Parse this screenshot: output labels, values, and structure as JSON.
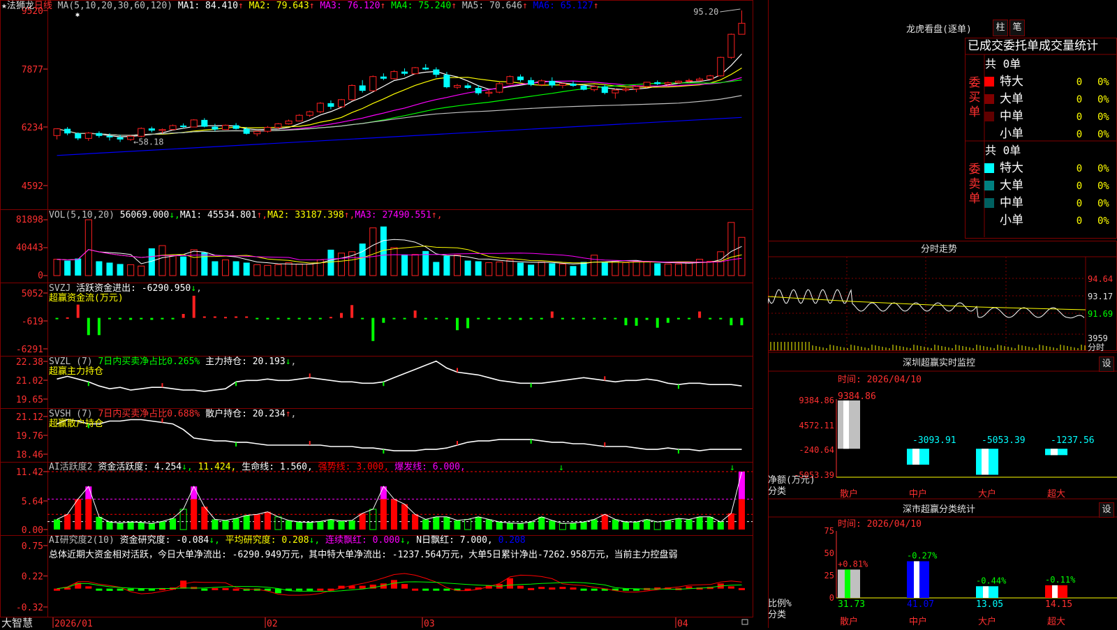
{
  "colors": {
    "up": "#ff2020",
    "down": "#00ffff",
    "ma1": "#ffffff",
    "ma2": "#ffff00",
    "ma3": "#ff00ff",
    "ma4": "#00ff00",
    "ma5": "#c0c0c0",
    "ma6": "#0000ff",
    "grid": "#800000"
  },
  "toolbar": {
    "title": "★法狮龙",
    "period": "日线"
  },
  "main": {
    "ma_label": "MA(5,10,20,30,60,120)",
    "ma": [
      {
        "label": "MA1: 84.410",
        "arrow": "↑",
        "color": "#ffffff"
      },
      {
        "label": "MA2: 79.643",
        "arrow": "↑",
        "color": "#ffff00"
      },
      {
        "label": "MA3: 76.120",
        "arrow": "↑",
        "color": "#ff00ff"
      },
      {
        "label": "MA4: 75.240",
        "arrow": "↑",
        "color": "#00ff00"
      },
      {
        "label": "MA5: 70.646",
        "arrow": "↑",
        "color": "#c0c0c0"
      },
      {
        "label": "MA6: 65.127",
        "arrow": "↑",
        "color": "#0000ff"
      }
    ],
    "y_ticks": [
      "9520",
      "7877",
      "6234",
      "4592"
    ],
    "high_label": "95.20",
    "low_label": "←58.18",
    "candles": [
      [
        60,
        62,
        58.9,
        61.9
      ],
      [
        61.9,
        62.4,
        60.1,
        60.6
      ],
      [
        60.6,
        60.9,
        58.7,
        59.2
      ],
      [
        59.2,
        61,
        58.5,
        60.7
      ],
      [
        60.7,
        61.2,
        59.4,
        59.9
      ],
      [
        59.9,
        60.6,
        58.6,
        59.5
      ],
      [
        59.5,
        60.2,
        58.2,
        58.9
      ],
      [
        58.9,
        60.1,
        58.5,
        59.8
      ],
      [
        59.8,
        62.3,
        59.5,
        62
      ],
      [
        62,
        62.5,
        60.9,
        61.4
      ],
      [
        61.4,
        62,
        60.6,
        61.7
      ],
      [
        61.7,
        63.1,
        61.5,
        62.8
      ],
      [
        62.8,
        63.4,
        62,
        62.4
      ],
      [
        62.4,
        64.6,
        62.4,
        64.4
      ],
      [
        64.4,
        64.9,
        62.3,
        62.5
      ],
      [
        62.5,
        63.3,
        61.2,
        61.7
      ],
      [
        61.7,
        63.1,
        61.6,
        62.9
      ],
      [
        62.9,
        63.5,
        61.7,
        61.9
      ],
      [
        61.9,
        62.4,
        60.3,
        60.5
      ],
      [
        60.5,
        61.4,
        59.8,
        61.2
      ],
      [
        61.2,
        62.7,
        60.8,
        62.3
      ],
      [
        62.3,
        63.5,
        61.8,
        63.3
      ],
      [
        63.3,
        64.5,
        63.1,
        64.1
      ],
      [
        64.1,
        66,
        64,
        65.7
      ],
      [
        65.7,
        67,
        65.2,
        66.7
      ],
      [
        66.7,
        69.4,
        66.3,
        69.1
      ],
      [
        69.1,
        69.9,
        67.4,
        68.1
      ],
      [
        68.1,
        70.3,
        68,
        70.1
      ],
      [
        70.1,
        74.4,
        69.8,
        74.1
      ],
      [
        74.1,
        75.6,
        72.1,
        72.6
      ],
      [
        72.6,
        76.9,
        72.4,
        76.6
      ],
      [
        76.6,
        77.5,
        75.6,
        76
      ],
      [
        76,
        78.4,
        75.8,
        78
      ],
      [
        78,
        78.9,
        76.9,
        77.4
      ],
      [
        77.4,
        79.3,
        77.2,
        79.1
      ],
      [
        79.1,
        80.1,
        78.4,
        78.6
      ],
      [
        78.6,
        79.2,
        76.4,
        77.1
      ],
      [
        77.1,
        77.9,
        73.3,
        73.6
      ],
      [
        73.6,
        74.5,
        73.1,
        74.1
      ],
      [
        74.1,
        74.7,
        73.1,
        73.4
      ],
      [
        73.4,
        74.2,
        71.4,
        71.9
      ],
      [
        71.9,
        73,
        70.9,
        72.2
      ],
      [
        72.2,
        75,
        71.9,
        74.6
      ],
      [
        74.6,
        76.9,
        74.4,
        76.6
      ],
      [
        76.6,
        77.2,
        75.1,
        75.6
      ],
      [
        75.6,
        76.4,
        73.9,
        74.3
      ],
      [
        74.3,
        75.8,
        73.9,
        75.4
      ],
      [
        75.4,
        76.4,
        73.5,
        74.1
      ],
      [
        74.1,
        74.8,
        73.3,
        74.6
      ],
      [
        74.6,
        75.3,
        73.7,
        74
      ],
      [
        74,
        74.4,
        72.7,
        72.9
      ],
      [
        72.9,
        74.2,
        72.4,
        73.8
      ],
      [
        73.8,
        74.4,
        71.6,
        72
      ],
      [
        72,
        73.2,
        70.4,
        72.8
      ],
      [
        72.8,
        73.5,
        72.3,
        73.1
      ],
      [
        73.1,
        74.1,
        72.2,
        73.8
      ],
      [
        73.8,
        75.1,
        73.4,
        75
      ],
      [
        75,
        75.5,
        74.2,
        74.5
      ],
      [
        74.5,
        75.2,
        74,
        74.9
      ],
      [
        74.9,
        75.5,
        74.6,
        75.3
      ],
      [
        75.3,
        76,
        74.9,
        75.5
      ],
      [
        75.5,
        76.4,
        75.3,
        75.9
      ],
      [
        75.9,
        77.1,
        75.5,
        76.8
      ],
      [
        76.8,
        82.2,
        76.6,
        82
      ],
      [
        82,
        88.7,
        81.6,
        88.5
      ],
      [
        88.5,
        95.2,
        88.5,
        91.6
      ]
    ],
    "ma6_range": [
      54.4,
      65.1
    ]
  },
  "vol": {
    "label": "VOL(5,10,20)",
    "value": "56069.000",
    "arrow": "↓",
    "ma": [
      {
        "label": "MA1: 45534.801",
        "arrow": "↑",
        "color": "#ffffff"
      },
      {
        "label": "MA2: 33187.398",
        "arrow": "↑",
        "color": "#ffff00"
      },
      {
        "label": "MA3: 27490.551",
        "arrow": "↑",
        "color": "#ff00ff"
      }
    ],
    "y_ticks": [
      "81898",
      "40443",
      "0"
    ],
    "values": [
      24000,
      22000,
      25000,
      81898,
      21000,
      19000,
      17000,
      16000,
      14000,
      40000,
      44000,
      29000,
      28000,
      38000,
      34000,
      21000,
      23000,
      21000,
      19000,
      16000,
      15000,
      16000,
      19000,
      17000,
      17000,
      23000,
      38000,
      33000,
      35000,
      47000,
      70000,
      72000,
      41000,
      31000,
      31000,
      36000,
      20000,
      29000,
      30000,
      22000,
      21000,
      19000,
      20000,
      23000,
      19000,
      16000,
      20000,
      18000,
      17000,
      14000,
      20000,
      30000,
      20000,
      21000,
      19000,
      21000,
      20000,
      18000,
      17000,
      17000,
      19000,
      24000,
      21000,
      35000,
      78000,
      56069
    ]
  },
  "svzj": {
    "label": "SVZJ",
    "text": "活跃资金进出: -6290.950",
    "arrow": "↓",
    "suffix": ",",
    "sub": "超赢资金流(万元)",
    "y_ticks": [
      "5052",
      "-619",
      "-6291"
    ],
    "values": [
      -200,
      100,
      2700,
      -3500,
      -3500,
      -200,
      -300,
      -400,
      -300,
      -400,
      -300,
      -300,
      800,
      4500,
      300,
      300,
      200,
      300,
      300,
      -200,
      -300,
      -200,
      -300,
      -200,
      -300,
      -200,
      200,
      1000,
      2600,
      -200,
      -4700,
      -1000,
      -200,
      -200,
      1500,
      -300,
      -200,
      -200,
      -2500,
      -2100,
      -200,
      -300,
      -300,
      -300,
      -400,
      -300,
      -300,
      1300,
      -300,
      -200,
      -300,
      -200,
      -300,
      -200,
      -1500,
      -1600,
      -400,
      -2000,
      -1000,
      -300,
      -200,
      1300,
      -300,
      -300,
      -1500,
      -1500,
      500,
      -200,
      -6291
    ],
    "range": [
      -6291,
      5052
    ]
  },
  "svzl": {
    "label": "SVZL (7)",
    "text1": "7日内买卖净占比0.265%",
    "text2": "主力持仓: 20.193",
    "arrow": "↓",
    "suffix": ",",
    "sub": "超赢主力持仓",
    "y_ticks": [
      "22.38",
      "21.02",
      "19.65"
    ],
    "values": [
      21.1,
      21.3,
      21.1,
      20.9,
      20.6,
      20.4,
      20.5,
      20.3,
      20.4,
      20.5,
      20.5,
      20.4,
      20.3,
      20.3,
      20.2,
      20.3,
      20.4,
      20.9,
      21,
      21,
      21.1,
      21,
      21,
      21.1,
      21.2,
      21.1,
      21,
      20.9,
      20.9,
      20.8,
      20.8,
      20.9,
      21.2,
      21.5,
      21.8,
      22.1,
      22.4,
      21.9,
      21.6,
      21.5,
      21.4,
      21.2,
      21,
      20.9,
      20.8,
      20.8,
      20.8,
      20.9,
      21,
      21.1,
      21.2,
      21.1,
      21,
      20.9,
      21,
      21,
      21.1,
      21,
      20.8,
      20.7,
      20.8,
      20.8,
      20.7,
      20.7,
      20.7,
      20.6,
      20.6,
      20.6,
      20.5,
      20.5,
      20.4,
      20.2,
      19.8
    ],
    "range": [
      19.65,
      22.38
    ]
  },
  "svsh": {
    "label": "SVSH (7)",
    "text1": "7日内买卖净占比0.688%",
    "text2": "散户持仓: 20.234",
    "arrow": "↑",
    "suffix": ",",
    "sub": "超赢散户持仓",
    "y_ticks": [
      "21.12",
      "19.76",
      "18.46"
    ],
    "values": [
      20.6,
      20.9,
      20.8,
      20.6,
      20.6,
      20.8,
      20.8,
      20.9,
      20.9,
      20.8,
      20.7,
      20.6,
      20.2,
      19.6,
      19.5,
      19.4,
      19.4,
      19.3,
      19.3,
      19.2,
      19.1,
      19.1,
      19.1,
      19.1,
      19.1,
      19.1,
      19,
      19,
      19,
      18.9,
      18.9,
      18.8,
      18.7,
      18.7,
      18.7,
      18.8,
      18.8,
      18.9,
      19.1,
      19.3,
      19.4,
      19.4,
      19.5,
      19.5,
      19.5,
      19.5,
      19.4,
      19.3,
      19.3,
      19.2,
      19.2,
      19.1,
      19,
      19,
      19,
      18.9,
      18.8,
      18.8,
      18.9,
      18.8,
      18.8,
      18.7,
      18.8,
      18.8,
      18.8,
      18.8,
      18.7,
      18.7,
      18.8,
      18.9,
      18.9,
      19,
      19.1,
      19.3,
      20.2
    ],
    "range": [
      18.46,
      21.12
    ]
  },
  "ai1": {
    "label": "AI活跃度2",
    "text1": "资金活跃度: 4.254",
    "arrow": "↓",
    "text2": "11.424",
    "text3": "生命线: 1.560",
    "text4": "强势线: 3.000",
    "text5": "爆发线: 6.000",
    "y_ticks": [
      "11.42",
      "5.64",
      "0.00"
    ],
    "values": [
      2,
      3,
      6,
      8.5,
      2.5,
      1.5,
      1.3,
      1.5,
      1.4,
      1.2,
      1.6,
      2.2,
      4,
      8.5,
      4.5,
      2,
      1.8,
      2.2,
      2.8,
      3,
      3.5,
      2.5,
      1.8,
      1.5,
      1.4,
      1.6,
      2,
      1.7,
      1.8,
      3.2,
      4,
      8.5,
      6,
      5,
      3,
      2,
      2.5,
      2.5,
      1.8,
      2,
      2.5,
      2,
      1.5,
      1.3,
      1.2,
      1.5,
      2.5,
      1.8,
      1.2,
      1.3,
      1.5,
      2,
      3,
      2,
      1.5,
      1.5,
      2,
      1.5,
      1.8,
      2.2,
      2,
      2.5,
      2.5,
      1.5,
      3.2,
      11.42,
      4.254
    ],
    "max": 11.42
  },
  "ai2": {
    "label": "AI研究度2(10)",
    "text1": "资金研究度: -0.084",
    "arrow1": "↓",
    "text2": "平均研究度: 0.208",
    "arrow2": "↓",
    "text3": "连续飘红: 0.000",
    "arrow3": "↓",
    "text4": "N日飘红: 7.000",
    "text5": "0.208",
    "y_ticks": [
      "0.75",
      "0.22",
      "-0.32"
    ],
    "summary": "总体近期大资金相对活跃，今日大单净流出: -6290.949万元，其中特大单净流出: -1237.564万元，大单5日累计净出-7262.958万元，当前主力控盘弱",
    "values": [
      0,
      0.02,
      0.1,
      0.04,
      -0.03,
      -0.04,
      -0.03,
      -0.03,
      -0.02,
      -0.01,
      0.01,
      0.02,
      0.14,
      0.03,
      -0.02,
      0.01,
      0.01,
      0,
      -0.02,
      -0.02,
      -0.04,
      -0.08,
      -0.03,
      -0.02,
      -0.01,
      0,
      0,
      0.05,
      0.05,
      0.05,
      0.07,
      0.09,
      0.15,
      0.08,
      0,
      -0.02,
      -0.02,
      -0.01,
      -0.01,
      0,
      0.02,
      0.06,
      0.08,
      0.18,
      0.05,
      0.01,
      0.03,
      0.02,
      0.03,
      0.02,
      -0.01,
      -0.02,
      -0.02,
      -0.03,
      -0.02,
      -0.01,
      0.01,
      0.02,
      0.02,
      0.01,
      0.04,
      0.02,
      0.03,
      0.09,
      0.04,
      0.01,
      0.05,
      0.12,
      0.14,
      -0.084
    ],
    "range": [
      -0.32,
      0.75
    ]
  },
  "dates": [
    "2026/01",
    "02",
    "03",
    "04"
  ],
  "brand": "大智慧",
  "side": {
    "dragon_title": "龙虎看盘(逐单)",
    "btn_bar": "柱",
    "btn_pen": "笔",
    "stat_title": "已成交委托单成交量统计",
    "buy": {
      "side_label": "委买单",
      "total": "共 0单",
      "rows": [
        [
          "特大",
          "0",
          "0%",
          "#ff0000"
        ],
        [
          "大单",
          "0",
          "0%",
          "#800000"
        ],
        [
          "中单",
          "0",
          "0%",
          "#600000"
        ],
        [
          "小单",
          "0",
          "0%",
          ""
        ]
      ]
    },
    "sell": {
      "side_label": "委卖单",
      "total": "共 0单",
      "rows": [
        [
          "特大",
          "0",
          "0%",
          "#00ffff"
        ],
        [
          "大单",
          "0",
          "0%",
          "#008080"
        ],
        [
          "中单",
          "0",
          "0%",
          "#006060"
        ],
        [
          "小单",
          "0",
          "0%",
          ""
        ]
      ]
    },
    "minute_title": "分时走势",
    "minute_ticks": [
      "94.64",
      "93.17",
      "91.69"
    ],
    "minute_vol_tick": "3959",
    "minute_unit": "分时",
    "monitor_title": "深圳超赢实时监控",
    "monitor_set": "设",
    "monitor_time": "时间: 2026/04/10",
    "monitor_ticks": [
      "9384.86",
      "4572.11",
      "-240.64",
      "-5053.39"
    ],
    "monitor_bars": [
      {
        "label": "散户",
        "value": "9384.86",
        "num": 9384.86
      },
      {
        "label": "中户",
        "value": "-3093.91",
        "num": -3093.91
      },
      {
        "label": "大户",
        "value": "-5053.39",
        "num": -5053.39
      },
      {
        "label": "超大",
        "value": "-1237.56",
        "num": -1237.56
      }
    ],
    "monitor_unit": "净额(万元)",
    "monitor_cat": "分类",
    "class_title": "深市超赢分类统计",
    "class_set": "设",
    "class_time": "时间: 2026/04/10",
    "class_ticks": [
      "75",
      "50",
      "25",
      "0"
    ],
    "class_bars": [
      {
        "label": "散户",
        "top": "+0.81%",
        "bottom": "31.73",
        "num": 31.73
      },
      {
        "label": "中户",
        "top": "-0.27%",
        "bottom": "41.07",
        "num": 41.07
      },
      {
        "label": "大户",
        "top": "-0.44%",
        "bottom": "13.05",
        "num": 13.05
      },
      {
        "label": "超大",
        "top": "-0.11%",
        "bottom": "14.15",
        "num": 14.15
      }
    ],
    "class_unit": "比例%",
    "class_cat": "分类"
  }
}
